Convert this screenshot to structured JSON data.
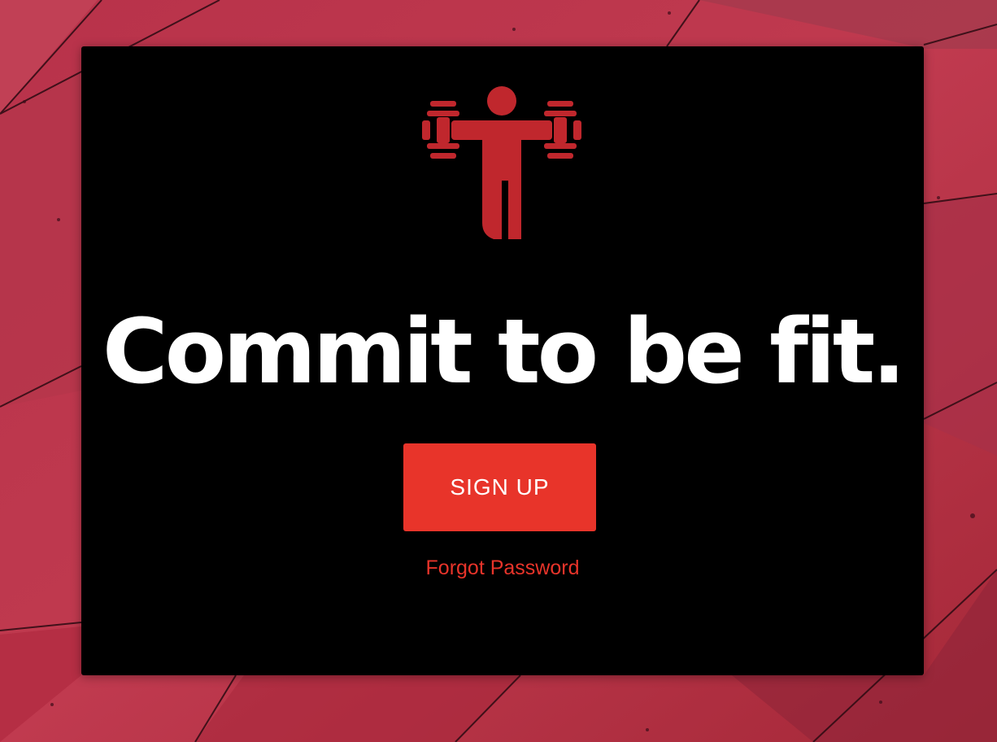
{
  "hero": {
    "headline": "Commit to be fit.",
    "logo_icon": "weightlifter-icon"
  },
  "actions": {
    "signup_label": "SIGN UP",
    "forgot_label": "Forgot Password"
  },
  "colors": {
    "background": "#b8324a",
    "card": "#000000",
    "accent": "#e8342a",
    "logo": "#c0272d",
    "headline": "#ffffff"
  }
}
